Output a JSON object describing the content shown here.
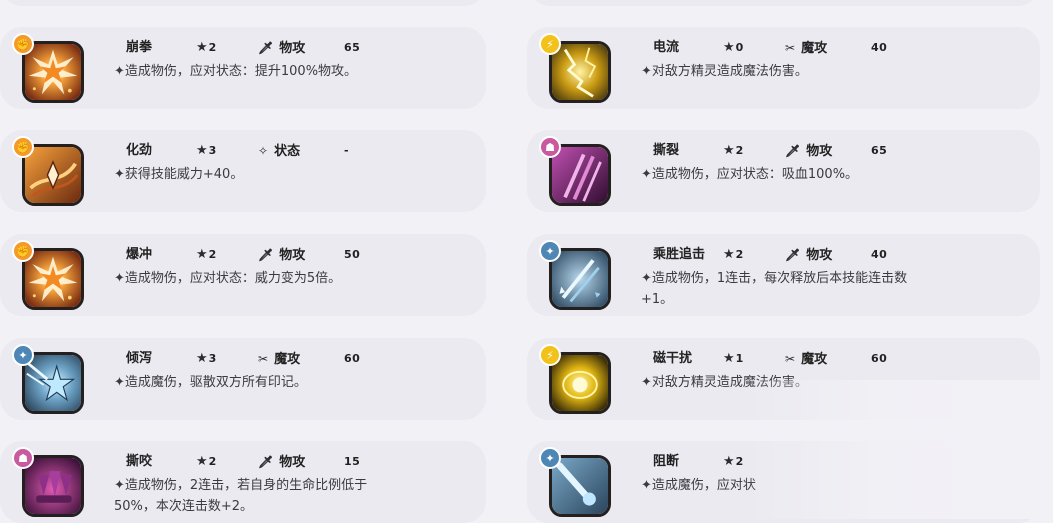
{
  "colors": {
    "page_bg": "#f2f1f6",
    "card_bg": "#ebeaf0",
    "badge_fire": "#f39a2a",
    "badge_electric": "#f2c21a",
    "badge_evil": "#c85aa0",
    "badge_light": "#4e86b5"
  },
  "skills": [
    {
      "name": "崩拳",
      "star_icon": "star-icon",
      "energy": "2",
      "category_icon": "sword-icon",
      "category": "物攻",
      "power": "65",
      "description": "✦造成物伤，应对状态：提升100%物攻。",
      "badge_icon": "fist-icon",
      "badge_color": "#f39a2a",
      "art_theme": "orange-burst"
    },
    {
      "name": "化劲",
      "star_icon": "star-icon",
      "energy": "3",
      "category_icon": "sparkle-icon",
      "category": "状态",
      "power": "-",
      "description": "✦获得技能威力+40。",
      "badge_icon": "fist-icon",
      "badge_color": "#f39a2a",
      "art_theme": "orange-swirl"
    },
    {
      "name": "爆冲",
      "star_icon": "star-icon",
      "energy": "2",
      "category_icon": "sword-icon",
      "category": "物攻",
      "power": "50",
      "description": "✦造成物伤，应对状态：威力变为5倍。",
      "badge_icon": "fist-icon",
      "badge_color": "#f39a2a",
      "art_theme": "orange-burst"
    },
    {
      "name": "倾泻",
      "star_icon": "star-icon",
      "energy": "3",
      "category_icon": "wand-icon",
      "category": "魔攻",
      "power": "60",
      "description": "✦造成魔伤，驱散双方所有印记。",
      "badge_icon": "light-icon",
      "badge_color": "#4e86b5",
      "art_theme": "blue-star"
    },
    {
      "name": "撕咬",
      "star_icon": "star-icon",
      "energy": "2",
      "category_icon": "sword-icon",
      "category": "物攻",
      "power": "15",
      "description": "✦造成物伤，2连击，若自身的生命比例低于50%，本次连击数+2。",
      "badge_icon": "evil-icon",
      "badge_color": "#c85aa0",
      "art_theme": "purple-fangs"
    },
    {
      "name": "电流",
      "star_icon": "star-icon",
      "energy": "0",
      "category_icon": "wand-icon",
      "category": "魔攻",
      "power": "40",
      "description": "✦对敌方精灵造成魔法伤害。",
      "badge_icon": "bolt-icon",
      "badge_color": "#f2c21a",
      "art_theme": "gold-lightning"
    },
    {
      "name": "撕裂",
      "star_icon": "star-icon",
      "energy": "2",
      "category_icon": "sword-icon",
      "category": "物攻",
      "power": "65",
      "description": "✦造成物伤，应对状态：吸血100%。",
      "badge_icon": "evil-icon",
      "badge_color": "#c85aa0",
      "art_theme": "purple-claws"
    },
    {
      "name": "乘胜追击",
      "star_icon": "star-icon",
      "energy": "2",
      "category_icon": "sword-icon",
      "category": "物攻",
      "power": "40",
      "description": "✦造成物伤，1连击，每次释放后本技能连击数+1。",
      "badge_icon": "light-icon",
      "badge_color": "#4e86b5",
      "art_theme": "blue-slash"
    },
    {
      "name": "磁干扰",
      "star_icon": "star-icon",
      "energy": "1",
      "category_icon": "wand-icon",
      "category": "魔攻",
      "power": "60",
      "description": "✦对敌方精灵造成魔法伤害。",
      "badge_icon": "bolt-icon",
      "badge_color": "#f2c21a",
      "art_theme": "gold-orb"
    },
    {
      "name": "阻断",
      "star_icon": "star-icon",
      "energy": "2",
      "category_icon": "",
      "category": "",
      "power": "",
      "description": "✦造成魔伤，应对状",
      "badge_icon": "light-icon",
      "badge_color": "#4e86b5",
      "art_theme": "blue-comet"
    }
  ]
}
